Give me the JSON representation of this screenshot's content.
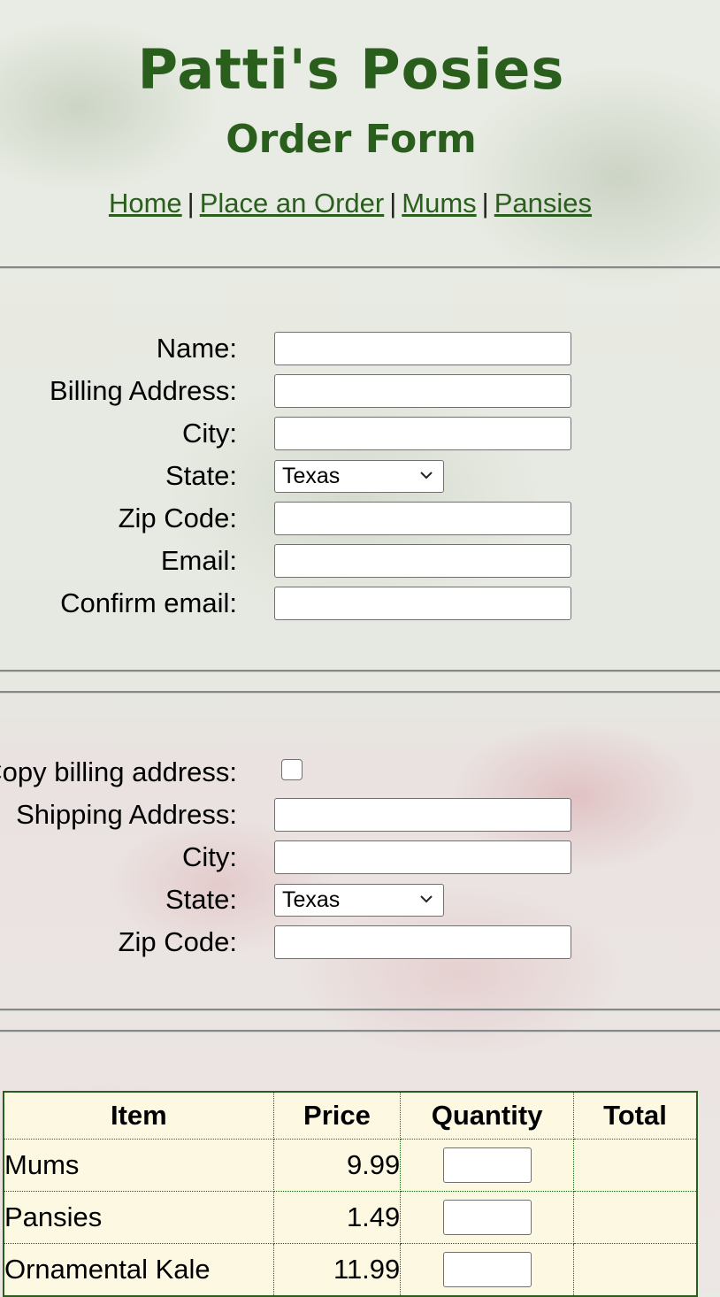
{
  "header": {
    "title": "Patti's Posies",
    "subtitle": "Order Form"
  },
  "nav": {
    "links": [
      "Home",
      "Place an Order",
      "Mums",
      "Pansies"
    ],
    "separator": "|"
  },
  "billing": {
    "name_label": "Name:",
    "address_label": "Billing Address:",
    "city_label": "City:",
    "state_label": "State:",
    "state_value": "Texas",
    "zip_label": "Zip Code:",
    "email_label": "Email:",
    "confirm_email_label": "Confirm email:"
  },
  "shipping": {
    "copy_label": "Copy billing address:",
    "address_label": "Shipping Address:",
    "city_label": "City:",
    "state_label": "State:",
    "state_value": "Texas",
    "zip_label": "Zip Code:"
  },
  "order_table": {
    "headers": [
      "Item",
      "Price",
      "Quantity",
      "Total"
    ],
    "rows": [
      {
        "item": "Mums",
        "price": "9.99"
      },
      {
        "item": "Pansies",
        "price": "1.49"
      },
      {
        "item": "Ornamental Kale",
        "price": "11.99"
      }
    ]
  },
  "icons": {
    "select_arrow": "chevron-down-icon"
  },
  "colors": {
    "brand_green": "#2a5e1d",
    "table_bg": "#fcf8e2"
  }
}
